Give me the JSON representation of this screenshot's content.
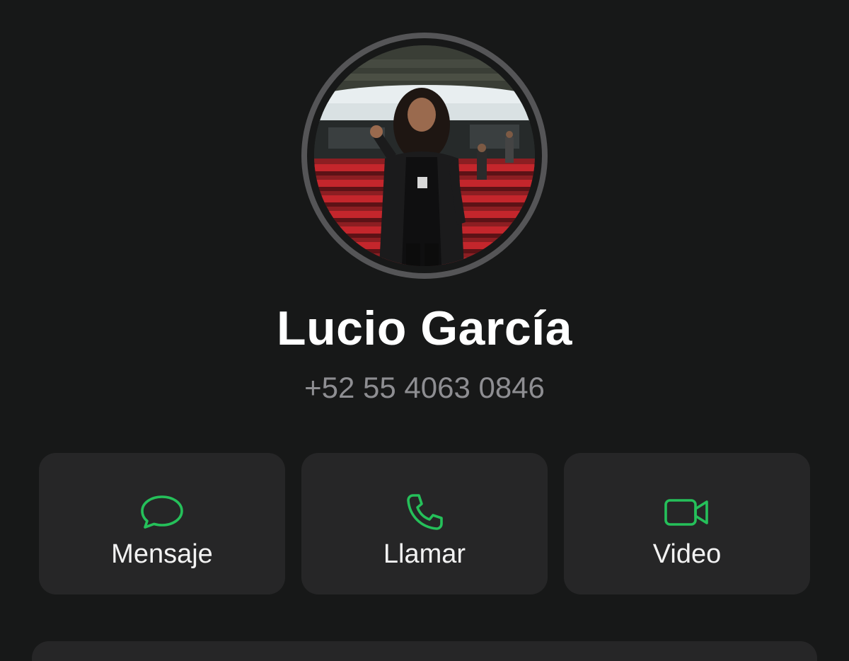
{
  "contact": {
    "name": "Lucio García",
    "phone": "+52 55 4063 0846"
  },
  "actions": [
    {
      "label": "Mensaje",
      "icon": "message-bubble-icon"
    },
    {
      "label": "Llamar",
      "icon": "phone-icon"
    },
    {
      "label": "Video",
      "icon": "video-camera-icon"
    }
  ],
  "colors": {
    "background": "#171818",
    "card": "#262627",
    "accent": "#25c05a",
    "name_text": "#ffffff",
    "phone_text": "#8e8e92"
  }
}
